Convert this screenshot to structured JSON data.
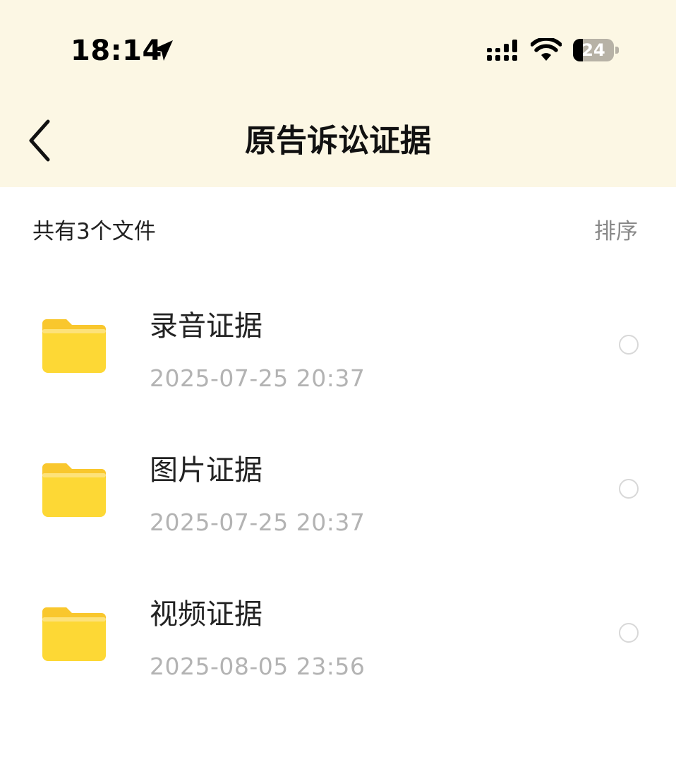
{
  "status_bar": {
    "time": "18:14",
    "battery_level": "24",
    "icons": [
      "location-arrow-icon",
      "signal-icon",
      "wifi-icon",
      "battery-icon"
    ]
  },
  "header": {
    "title": "原告诉讼证据",
    "back_icon": "chevron-left-icon"
  },
  "summary": {
    "file_count_text": "共有3个文件",
    "sort_label": "排序"
  },
  "files": [
    {
      "name": "录音证据",
      "date": "2025-07-25 20:37",
      "icon": "folder-icon"
    },
    {
      "name": "图片证据",
      "date": "2025-07-25 20:37",
      "icon": "folder-icon"
    },
    {
      "name": "视频证据",
      "date": "2025-08-05 23:56",
      "icon": "folder-icon"
    }
  ],
  "colors": {
    "header_background": "#fcf7e4",
    "folder_yellow": "#fdd835",
    "date_gray": "#b3b3b3",
    "sort_gray": "#888888"
  }
}
